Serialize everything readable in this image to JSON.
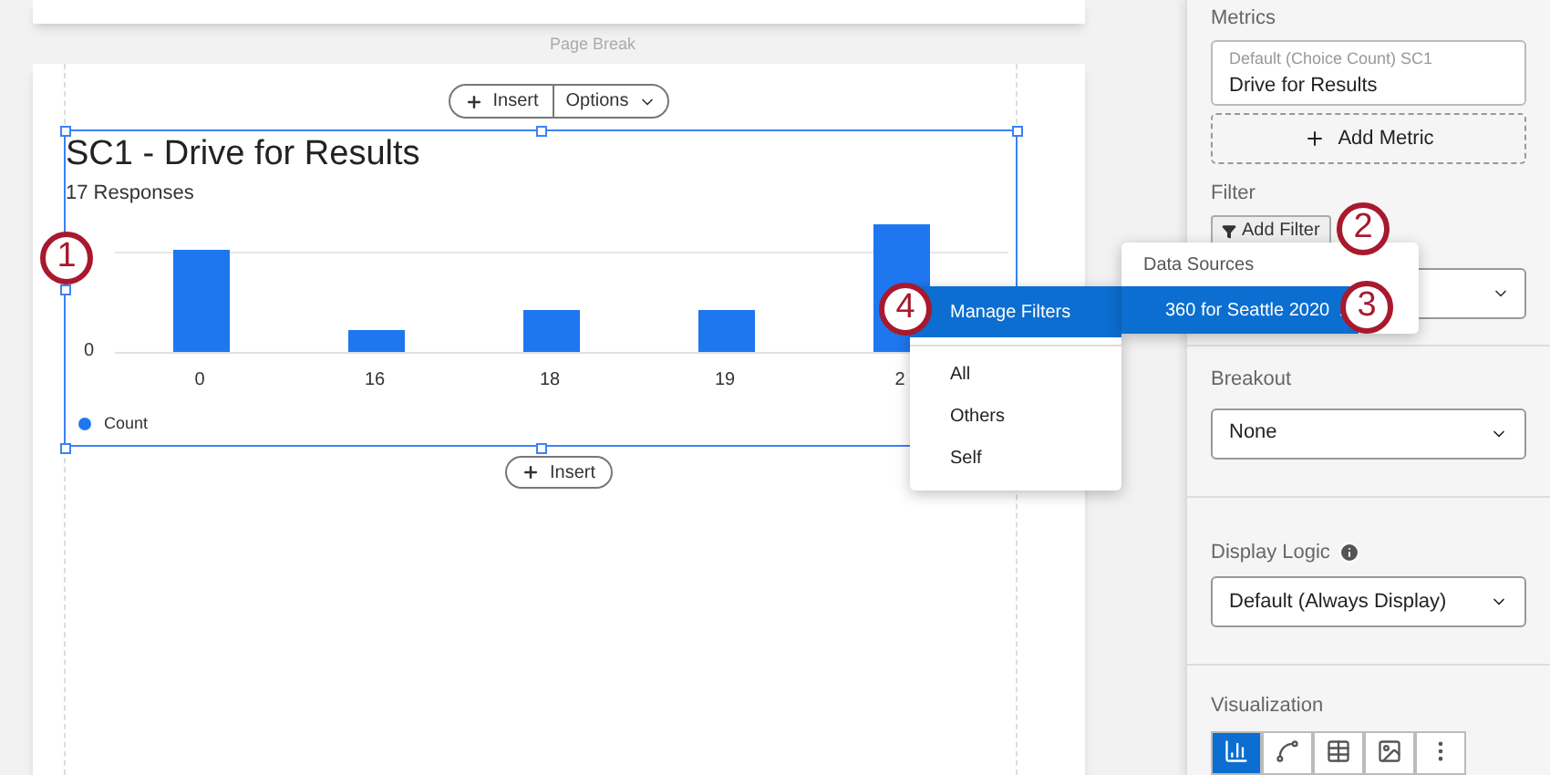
{
  "page_break": "Page Break",
  "toolbar": {
    "insert": "Insert",
    "options": "Options"
  },
  "widget": {
    "title": "SC1 - Drive for Results",
    "subtitle": "17 Responses",
    "y_tick": "0",
    "categories": [
      "0",
      "16",
      "18",
      "19",
      "2"
    ],
    "legend": "Count",
    "insert_below": "Insert"
  },
  "panel": {
    "metrics_label": "Metrics",
    "metric": {
      "caption": "Default (Choice Count) SC1",
      "name": "Drive for Results"
    },
    "add_metric": "Add Metric",
    "filter_label": "Filter",
    "add_filter": "Add Filter",
    "breakout_label": "Breakout",
    "breakout_value": "None",
    "display_logic_label": "Display Logic",
    "display_logic_value": "Default (Always Display)",
    "visualization_label": "Visualization",
    "visualization_options": [
      {
        "kind": "bar",
        "selected": true
      },
      {
        "kind": "line",
        "selected": false
      },
      {
        "kind": "table",
        "selected": false
      },
      {
        "kind": "image",
        "selected": false
      },
      {
        "kind": "more",
        "selected": false
      }
    ]
  },
  "filter_menu": [
    {
      "label": "Manage Filters",
      "selected": true
    },
    {
      "label": "All",
      "selected": false
    },
    {
      "label": "Others",
      "selected": false
    },
    {
      "label": "Self",
      "selected": false
    }
  ],
  "sources_menu": {
    "heading": "Data Sources",
    "items": [
      {
        "label": "360 for Seattle 2020",
        "selected": true
      }
    ]
  },
  "callouts": [
    "1",
    "2",
    "3",
    "4"
  ]
}
